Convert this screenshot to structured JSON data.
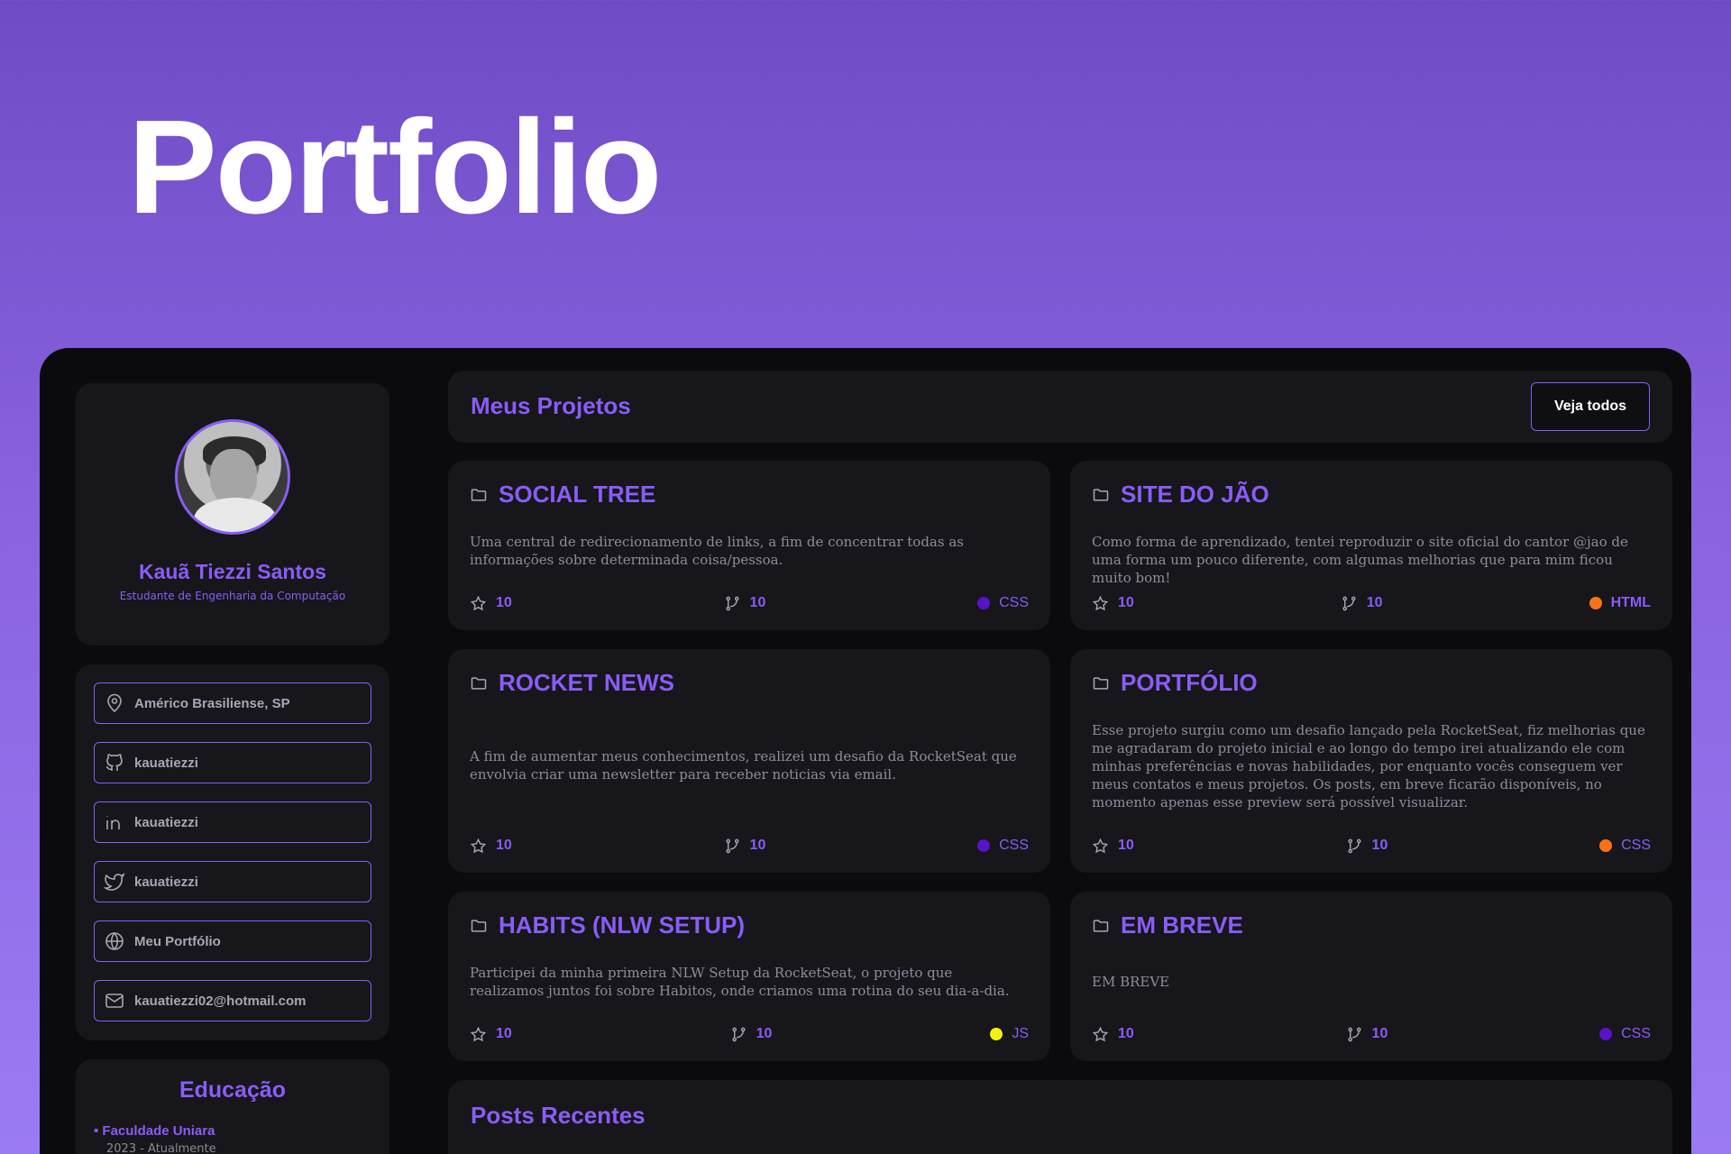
{
  "hero": {
    "title": "Portfolio"
  },
  "profile": {
    "name": "Kauã Tiezzi Santos",
    "role": "Estudante de Engenharia da Computação"
  },
  "contacts": [
    {
      "icon": "location-pin-icon",
      "label": "Américo Brasiliense, SP"
    },
    {
      "icon": "github-icon",
      "label": "kauatiezzi"
    },
    {
      "icon": "linkedin-icon",
      "label": "kauatiezzi"
    },
    {
      "icon": "twitter-icon",
      "label": "kauatiezzi"
    },
    {
      "icon": "globe-icon",
      "label": "Meu Portfólio"
    },
    {
      "icon": "mail-icon",
      "label": "kauatiezzi02@hotmail.com"
    }
  ],
  "education": {
    "title": "Educação",
    "item": "• Faculdade Uniara",
    "date": "2023 - Atualmente"
  },
  "projects_section": {
    "title": "Meus Projetos",
    "see_all": "Veja todos"
  },
  "projects": [
    {
      "title": "SOCIAL TREE",
      "description": "Uma central de redirecionamento de links, a fim de concentrar todas as informações sobre determinada coisa/pessoa.",
      "stars": "10",
      "forks": "10",
      "language": "CSS",
      "lang_color": "#5a12c7"
    },
    {
      "title": "SITE DO JÃO",
      "description": "Como forma de aprendizado, tentei reproduzir o site oficial do cantor @jao de uma forma um pouco diferente, com algumas melhorias que para mim ficou muito bom!",
      "stars": "10",
      "forks": "10",
      "language": "HTML",
      "lang_color": "#f97316"
    },
    {
      "title": "ROCKET NEWS",
      "description": "A fim de aumentar meus conhecimentos, realizei um desafio da RocketSeat que envolvia criar uma newsletter para receber noticias via email.",
      "stars": "10",
      "forks": "10",
      "language": "CSS",
      "lang_color": "#5a12c7"
    },
    {
      "title": "PORTFÓLIO",
      "description": "Esse projeto surgiu como um desafio lançado pela RocketSeat, fiz melhorias que me agradaram do projeto inicial e ao longo do tempo irei atualizando ele com minhas preferências e novas habilidades, por enquanto vocês conseguem ver meus contatos e meus projetos. Os posts, em breve ficarão disponíveis, no momento apenas esse preview será possível visualizar.",
      "stars": "10",
      "forks": "10",
      "language": "CSS",
      "lang_color": "#f97316"
    },
    {
      "title": "HABITS (NLW SETUP)",
      "description": "Participei da minha primeira NLW Setup da RocketSeat, o projeto que realizamos juntos foi sobre Habitos, onde criamos uma rotina do seu dia-a-dia.",
      "stars": "10",
      "forks": "10",
      "language": "JS",
      "lang_color": "#f2f20d"
    },
    {
      "title": "EM BREVE",
      "description": "EM BREVE",
      "stars": "10",
      "forks": "10",
      "language": "CSS",
      "lang_color": "#5a12c7"
    }
  ],
  "posts_section": {
    "title": "Posts Recentes"
  }
}
